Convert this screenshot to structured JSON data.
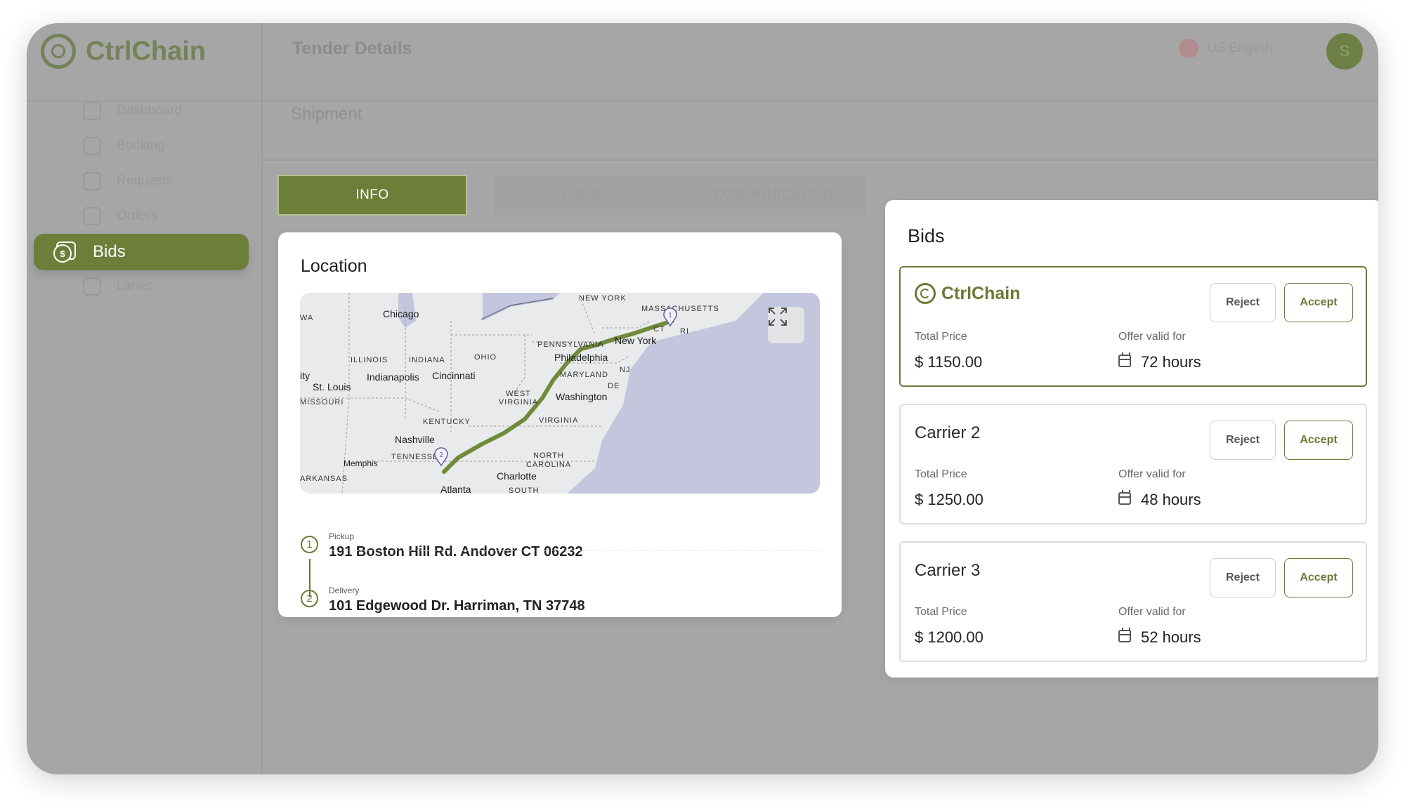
{
  "app": {
    "brand": "CtrlChain",
    "header_title": "Tender Details",
    "language": "US English",
    "user_initial": "S"
  },
  "sidebar": {
    "items": [
      {
        "label": "Dashboard"
      },
      {
        "label": "Booking"
      },
      {
        "label": "Requests"
      },
      {
        "label": "Orders"
      },
      {
        "label": "Bids"
      },
      {
        "label": "Lanes"
      }
    ],
    "active": "Bids"
  },
  "page": {
    "subtitle": "Shipment"
  },
  "tabs": [
    {
      "label": "INFO"
    },
    {
      "label": "CARGO"
    },
    {
      "label": "COMMUNICATION"
    }
  ],
  "location": {
    "title": "Location",
    "map": {
      "states": [
        "NEW YORK",
        "MASSACHUSETTS",
        "CT",
        "RI",
        "PENNSYLVANIA",
        "NJ",
        "ILLINOIS",
        "INDIANA",
        "OHIO",
        "MARYLAND",
        "DE",
        "WEST VIRGINIA",
        "VIRGINIA",
        "MISSOURI",
        "KENTUCKY",
        "TENNESSEE",
        "NORTH CAROLINA",
        "ARKANSAS",
        "SOUTH",
        "WA"
      ],
      "cities": [
        "Chicago",
        "New York",
        "Philadelphia",
        "Indianapolis",
        "Cincinnati",
        "St. Louis",
        "Washington",
        "Nashville",
        "Memphis",
        "Charlotte",
        "Atlanta",
        "ity"
      ],
      "markers": [
        "1",
        "2"
      ]
    },
    "pickup": {
      "label": "Pickup",
      "address": "191 Boston Hill Rd. Andover CT 06232",
      "index": "1"
    },
    "delivery": {
      "label": "Delivery",
      "address": "101 Edgewood Dr. Harriman, TN 37748",
      "index": "2"
    }
  },
  "bids": {
    "title": "Bids",
    "price_label": "Total Price",
    "validity_label": "Offer valid for",
    "reject_label": "Reject",
    "accept_label": "Accept",
    "items": [
      {
        "carrier": "CtrlChain",
        "price": "$ 1150.00",
        "valid": "72 hours"
      },
      {
        "carrier": "Carrier 2",
        "price": "$ 1250.00",
        "valid": "48 hours"
      },
      {
        "carrier": "Carrier 3",
        "price": "$ 1200.00",
        "valid": "52 hours"
      }
    ]
  },
  "colors": {
    "accent": "#6a7a37",
    "overlay": "#a6a6a6"
  }
}
